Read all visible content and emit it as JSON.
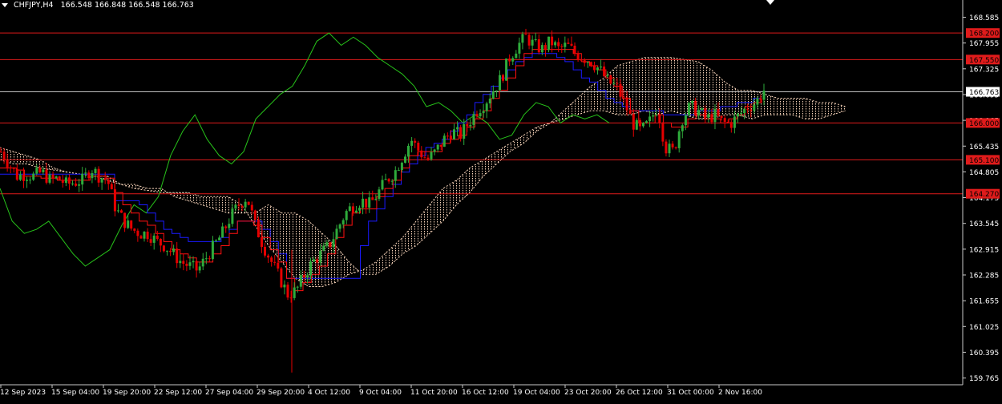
{
  "header": {
    "symbol": "CHFJPY,H4",
    "quote": "166.548 166.848 166.548 166.763"
  },
  "colors": {
    "background": "#000000",
    "grid_text": "#ffffff",
    "bull_candle": "#2eab3b",
    "bear_candle": "#e60000",
    "chikou": "#27c21a",
    "kijun": "#1a1aff",
    "tenkan": "#ff1010",
    "cloud": "#f5d2b8",
    "level_line": "#e01b1b",
    "level_label_bg": "#e01b1b",
    "current_price_line": "#ffffff"
  },
  "chart_data": {
    "type": "candlestick",
    "symbol": "CHFJPY",
    "timeframe": "H4",
    "ylim": [
      159.6,
      168.85
    ],
    "y_ticks": [
      "168.585",
      "167.955",
      "167.325",
      "166.695",
      "166.065",
      "165.435",
      "164.805",
      "164.175",
      "163.545",
      "162.915",
      "162.285",
      "161.655",
      "161.025",
      "160.395",
      "159.765"
    ],
    "x_ticks": [
      "12 Sep 2023",
      "15 Sep 04:00",
      "19 Sep 20:00",
      "22 Sep 12:00",
      "27 Sep 04:00",
      "29 Sep 20:00",
      "4 Oct 12:00",
      "9 Oct 04:00",
      "11 Oct 20:00",
      "16 Oct 12:00",
      "19 Oct 04:00",
      "23 Oct 20:00",
      "26 Oct 12:00",
      "31 Oct 00:00",
      "2 Nov 16:00"
    ],
    "levels": [
      {
        "value": "168.200"
      },
      {
        "value": "167.550"
      },
      {
        "value": "166.000"
      },
      {
        "value": "165.100"
      },
      {
        "value": "164.270"
      }
    ],
    "current_price": "166.763",
    "price_path": [
      165.3,
      165.0,
      164.7,
      164.75,
      164.7,
      164.8,
      164.6,
      164.65,
      164.5,
      164.55,
      164.6,
      164.9,
      164.7,
      164.6,
      163.9,
      163.6,
      163.4,
      163.3,
      163.3,
      163.1,
      163.0,
      162.8,
      162.6,
      162.5,
      162.4,
      162.7,
      163.0,
      163.3,
      163.7,
      164.0,
      164.2,
      163.5,
      163.0,
      162.6,
      162.2,
      161.8,
      161.9,
      162.3,
      162.6,
      162.8,
      163.0,
      163.4,
      163.8,
      164.0,
      164.1,
      164.0,
      164.3,
      164.6,
      164.8,
      165.2,
      165.6,
      165.3,
      165.1,
      165.3,
      165.6,
      165.8,
      165.7,
      166.0,
      166.3,
      166.5,
      166.8,
      167.1,
      167.6,
      167.9,
      168.1,
      167.9,
      167.8,
      168.0,
      167.8,
      167.9,
      167.7,
      167.6,
      167.5,
      167.3,
      167.0,
      166.9,
      166.5,
      166.0,
      165.8,
      166.0,
      166.4,
      165.4,
      165.3,
      166.1,
      166.4,
      166.3,
      166.1,
      166.2,
      166.0,
      166.0,
      166.2,
      166.4,
      166.5,
      166.8
    ],
    "tenkan_path": [
      164.9,
      164.9,
      164.85,
      164.7,
      164.7,
      164.65,
      164.65,
      164.6,
      164.6,
      164.6,
      164.6,
      164.7,
      164.7,
      164.65,
      164.3,
      164.0,
      163.8,
      163.6,
      163.5,
      163.3,
      163.1,
      162.9,
      162.8,
      162.7,
      162.6,
      162.6,
      162.8,
      163.0,
      163.3,
      163.6,
      163.6,
      163.5,
      163.2,
      162.9,
      162.6,
      162.2,
      161.9,
      162.1,
      162.3,
      162.5,
      162.8,
      163.2,
      163.5,
      163.8,
      163.9,
      163.9,
      164.2,
      164.4,
      164.6,
      164.9,
      165.2,
      165.3,
      165.3,
      165.3,
      165.5,
      165.6,
      165.7,
      165.9,
      166.1,
      166.3,
      166.6,
      166.8,
      167.1,
      167.4,
      167.7,
      167.8,
      167.8,
      167.8,
      167.8,
      167.8,
      167.7,
      167.5,
      167.4,
      167.3,
      167.1,
      166.9,
      166.6,
      166.3,
      166.0,
      166.0,
      166.2,
      166.0,
      165.9,
      165.9,
      166.1,
      166.2,
      166.1,
      166.1,
      166.0,
      166.1,
      166.2,
      166.4,
      166.5,
      166.6
    ],
    "kijun_path": [
      164.75,
      164.75,
      164.75,
      164.75,
      164.75,
      164.75,
      164.75,
      164.75,
      164.75,
      164.75,
      164.75,
      164.75,
      164.75,
      164.75,
      164.1,
      164.1,
      164.1,
      164.0,
      163.8,
      163.6,
      163.4,
      163.3,
      163.2,
      163.1,
      163.1,
      163.1,
      163.1,
      163.2,
      163.4,
      163.6,
      163.6,
      163.6,
      163.4,
      163.1,
      162.8,
      162.2,
      162.2,
      162.2,
      162.2,
      162.2,
      162.2,
      162.2,
      162.2,
      162.2,
      163.0,
      163.6,
      163.9,
      164.2,
      164.5,
      164.8,
      165.0,
      165.2,
      165.4,
      165.5,
      165.6,
      165.8,
      166.0,
      166.2,
      166.5,
      166.7,
      166.9,
      167.1,
      167.3,
      167.5,
      167.6,
      167.7,
      167.7,
      167.7,
      167.6,
      167.5,
      167.3,
      167.1,
      167.0,
      166.8,
      166.6,
      166.5,
      166.4,
      166.3,
      166.3,
      166.3,
      166.3,
      166.2,
      166.2,
      166.2,
      166.2,
      166.3,
      166.3,
      166.3,
      166.4,
      166.4,
      166.5,
      166.5,
      166.6,
      166.6
    ],
    "chikou_path": [
      164.4,
      163.6,
      163.3,
      163.4,
      163.6,
      163.2,
      162.8,
      162.5,
      162.7,
      162.9,
      163.5,
      164.0,
      163.8,
      164.2,
      165.2,
      165.8,
      166.2,
      165.6,
      165.2,
      165.0,
      165.3,
      166.1,
      166.4,
      166.7,
      166.9,
      167.4,
      168.0,
      168.2,
      167.9,
      168.1,
      167.9,
      167.6,
      167.4,
      167.2,
      166.9,
      166.4,
      166.5,
      166.3,
      166.0,
      166.2,
      166.0,
      165.6,
      165.7,
      166.2,
      166.5,
      166.4,
      166.0,
      166.2,
      166.1,
      166.2,
      166.0
    ],
    "cloud_top": [
      165.4,
      165.3,
      165.2,
      165.1,
      164.9,
      164.8,
      164.75,
      164.7,
      164.7,
      164.5,
      164.5,
      164.4,
      164.4,
      164.2,
      164.1,
      164.0,
      163.9,
      163.8,
      163.8,
      163.8,
      164.0,
      163.8,
      163.8,
      163.6,
      163.3,
      163.0,
      162.6,
      162.3,
      162.3,
      162.5,
      162.8,
      163.0,
      163.3,
      163.6,
      164.0,
      164.3,
      164.7,
      165.0,
      165.3,
      165.5,
      165.8,
      166.0,
      166.3,
      166.6,
      166.9,
      167.1,
      167.4,
      167.5,
      167.6,
      167.6,
      167.6,
      167.55,
      167.5,
      167.3,
      167.0,
      166.8,
      166.8,
      166.7,
      166.6,
      166.6,
      166.6,
      166.5,
      166.5,
      166.4
    ],
    "cloud_bottom": [
      165.1,
      165.0,
      165.0,
      164.9,
      164.85,
      164.8,
      164.75,
      164.7,
      164.6,
      164.5,
      164.4,
      164.35,
      164.3,
      164.3,
      164.3,
      164.2,
      164.2,
      164.2,
      164.0,
      163.5,
      163.0,
      162.6,
      162.2,
      162.0,
      162.0,
      162.1,
      162.3,
      162.4,
      162.6,
      162.9,
      163.2,
      163.6,
      164.0,
      164.4,
      164.6,
      164.9,
      165.1,
      165.3,
      165.5,
      165.7,
      165.9,
      166.0,
      166.1,
      166.2,
      166.3,
      166.3,
      166.2,
      166.2,
      166.3,
      166.2,
      166.3,
      166.2,
      166.1,
      166.1,
      166.2,
      166.2,
      166.1,
      166.2,
      166.2,
      166.2,
      166.1,
      166.1,
      166.2,
      166.3
    ]
  }
}
